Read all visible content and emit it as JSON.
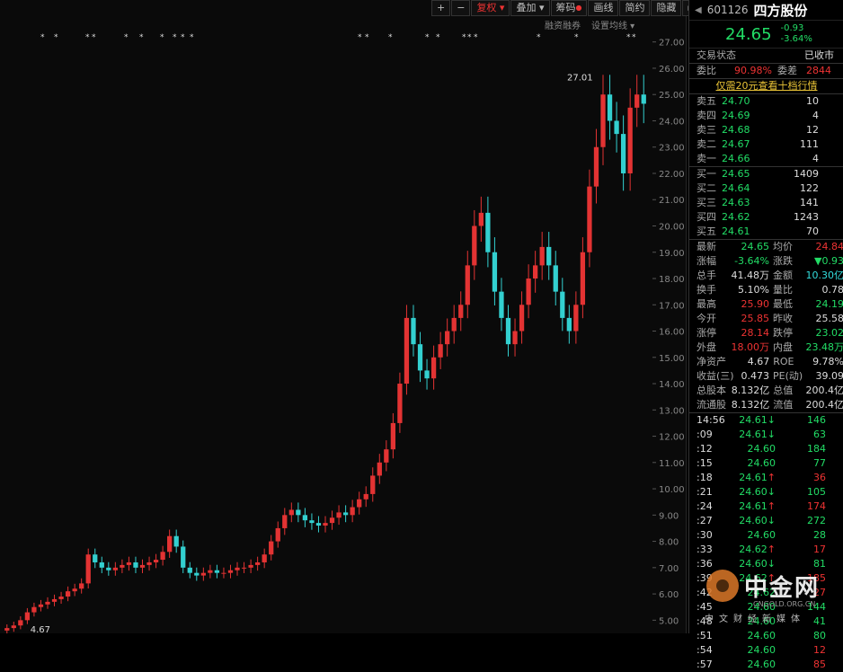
{
  "toolbar": {
    "plus": "+",
    "minus": "−",
    "adjust": "复权",
    "overlay": "叠加",
    "chips": "筹码",
    "draw": "画线",
    "brief": "简约",
    "hide": "隐藏",
    "next": "▸▸",
    "fullscreen": "⛶"
  },
  "sublinks": {
    "margin": "融资融券",
    "ma": "设置均线"
  },
  "chart_data": {
    "type": "candlestick",
    "y_ticks": [
      "27.00",
      "26.00",
      "25.00",
      "24.00",
      "23.00",
      "22.00",
      "21.00",
      "20.00",
      "19.00",
      "18.00",
      "17.00",
      "16.00",
      "15.00",
      "14.00",
      "13.00",
      "12.00",
      "11.00",
      "10.00",
      "9.00",
      "8.00",
      "7.00",
      "6.00",
      "5.00"
    ],
    "ylim": [
      4.67,
      27.4
    ],
    "high_label": "27.01",
    "low_label": "4.67",
    "closes": [
      4.7,
      4.8,
      5.0,
      5.3,
      5.5,
      5.6,
      5.7,
      5.8,
      5.9,
      6.1,
      6.2,
      6.4,
      7.5,
      7.2,
      7.0,
      6.9,
      7.0,
      7.1,
      7.2,
      7.0,
      7.1,
      7.2,
      7.3,
      7.6,
      8.2,
      7.8,
      7.0,
      6.8,
      6.7,
      6.8,
      6.9,
      6.8,
      6.8,
      6.9,
      7.0,
      7.0,
      7.1,
      7.2,
      7.5,
      8.0,
      8.5,
      9.0,
      9.2,
      9.0,
      8.8,
      8.7,
      8.6,
      8.7,
      8.9,
      9.1,
      9.0,
      9.3,
      9.6,
      9.8,
      10.5,
      11.0,
      11.5,
      12.5,
      14.0,
      16.5,
      15.5,
      14.5,
      14.2,
      15.0,
      15.5,
      16.0,
      16.5,
      17.0,
      18.5,
      20.0,
      20.5,
      19.0,
      17.5,
      16.5,
      15.5,
      16.0,
      17.0,
      18.0,
      18.5,
      19.2,
      18.5,
      17.5,
      16.5,
      16.0,
      17.0,
      19.0,
      21.5,
      23.0,
      25.0,
      24.0,
      23.5,
      22.0,
      24.5,
      25.0,
      24.65
    ]
  },
  "panel": {
    "code": "601126",
    "name": "四方股份",
    "price": "24.65",
    "change": "-0.93",
    "change_pct": "-3.64%",
    "status_label": "交易状态",
    "status_value": "已收市",
    "weibi_label": "委比",
    "weibi_value": "90.98%",
    "weicha_label": "委差",
    "weicha_value": "2844",
    "promo": "仅需20元查看十档行情",
    "asks": [
      {
        "label": "卖五",
        "price": "24.70",
        "vol": "10"
      },
      {
        "label": "卖四",
        "price": "24.69",
        "vol": "4"
      },
      {
        "label": "卖三",
        "price": "24.68",
        "vol": "12"
      },
      {
        "label": "卖二",
        "price": "24.67",
        "vol": "111"
      },
      {
        "label": "卖一",
        "price": "24.66",
        "vol": "4"
      }
    ],
    "bids": [
      {
        "label": "买一",
        "price": "24.65",
        "vol": "1409"
      },
      {
        "label": "买二",
        "price": "24.64",
        "vol": "122"
      },
      {
        "label": "买三",
        "price": "24.63",
        "vol": "141"
      },
      {
        "label": "买四",
        "price": "24.62",
        "vol": "1243"
      },
      {
        "label": "买五",
        "price": "24.61",
        "vol": "70"
      }
    ],
    "stats": [
      {
        "a": "最新",
        "b": "24.65",
        "bc": "green",
        "c": "均价",
        "d": "24.84",
        "dc": "red"
      },
      {
        "a": "涨幅",
        "b": "-3.64%",
        "bc": "green",
        "c": "涨跌",
        "d": "▼0.93",
        "dc": "green"
      },
      {
        "a": "总手",
        "b": "41.48万",
        "bc": "white",
        "c": "金额",
        "d": "10.30亿",
        "dc": "cyan"
      },
      {
        "a": "换手",
        "b": "5.10%",
        "bc": "white",
        "c": "量比",
        "d": "0.78",
        "dc": "white"
      },
      {
        "a": "最高",
        "b": "25.90",
        "bc": "red",
        "c": "最低",
        "d": "24.19",
        "dc": "green"
      },
      {
        "a": "今开",
        "b": "25.85",
        "bc": "red",
        "c": "昨收",
        "d": "25.58",
        "dc": "white"
      },
      {
        "a": "涨停",
        "b": "28.14",
        "bc": "red",
        "c": "跌停",
        "d": "23.02",
        "dc": "green"
      },
      {
        "a": "外盘",
        "b": "18.00万",
        "bc": "red",
        "c": "内盘",
        "d": "23.48万",
        "dc": "green"
      },
      {
        "a": "净资产",
        "b": "4.67",
        "bc": "white",
        "c": "ROE",
        "d": "9.78%",
        "dc": "white"
      },
      {
        "a": "收益(三)",
        "b": "0.473",
        "bc": "white",
        "c": "PE(动)",
        "d": "39.09",
        "dc": "white"
      },
      {
        "a": "总股本",
        "b": "8.132亿",
        "bc": "white",
        "c": "总值",
        "d": "200.4亿",
        "dc": "white"
      },
      {
        "a": "流通股",
        "b": "8.132亿",
        "bc": "white",
        "c": "流值",
        "d": "200.4亿",
        "dc": "white"
      }
    ],
    "ticks": [
      {
        "t": "14:56",
        "p": "24.61",
        "arrow": "↓",
        "ac": "green",
        "v": "146",
        "vc": "green"
      },
      {
        "t": ":09",
        "p": "24.61",
        "arrow": "↓",
        "ac": "green",
        "v": "63",
        "vc": "green"
      },
      {
        "t": ":12",
        "p": "24.60",
        "arrow": "",
        "ac": "green",
        "v": "184",
        "vc": "green"
      },
      {
        "t": ":15",
        "p": "24.60",
        "arrow": "",
        "ac": "green",
        "v": "77",
        "vc": "green"
      },
      {
        "t": ":18",
        "p": "24.61",
        "arrow": "↑",
        "ac": "red",
        "v": "36",
        "vc": "red"
      },
      {
        "t": ":21",
        "p": "24.60",
        "arrow": "↓",
        "ac": "green",
        "v": "105",
        "vc": "green"
      },
      {
        "t": ":24",
        "p": "24.61",
        "arrow": "↑",
        "ac": "red",
        "v": "174",
        "vc": "red"
      },
      {
        "t": ":27",
        "p": "24.60",
        "arrow": "↓",
        "ac": "green",
        "v": "272",
        "vc": "green"
      },
      {
        "t": ":30",
        "p": "24.60",
        "arrow": "",
        "ac": "green",
        "v": "28",
        "vc": "green"
      },
      {
        "t": ":33",
        "p": "24.62",
        "arrow": "↑",
        "ac": "red",
        "v": "17",
        "vc": "red"
      },
      {
        "t": ":36",
        "p": "24.60",
        "arrow": "↓",
        "ac": "green",
        "v": "81",
        "vc": "green"
      },
      {
        "t": ":39",
        "p": "24.62",
        "arrow": "↑",
        "ac": "red",
        "v": "185",
        "vc": "red"
      },
      {
        "t": ":42",
        "p": "24.62",
        "arrow": "",
        "ac": "green",
        "v": "27",
        "vc": "red"
      },
      {
        "t": ":45",
        "p": "24.60",
        "arrow": "",
        "ac": "green",
        "v": "144",
        "vc": "green"
      },
      {
        "t": ":48",
        "p": "24.60",
        "arrow": "",
        "ac": "green",
        "v": "41",
        "vc": "green"
      },
      {
        "t": ":51",
        "p": "24.60",
        "arrow": "",
        "ac": "green",
        "v": "80",
        "vc": "green"
      },
      {
        "t": ":54",
        "p": "24.60",
        "arrow": "",
        "ac": "green",
        "v": "12",
        "vc": "red"
      },
      {
        "t": ":57",
        "p": "24.60",
        "arrow": "",
        "ac": "green",
        "v": "85",
        "vc": "red"
      }
    ]
  },
  "watermark": {
    "brand": "中金网",
    "sub": "中文财经新媒体",
    "url": "CNGOLD.ORG.CN"
  },
  "colors": {
    "up": "#e33333",
    "down": "#33d0d0",
    "bg": "#0a0a0a"
  }
}
